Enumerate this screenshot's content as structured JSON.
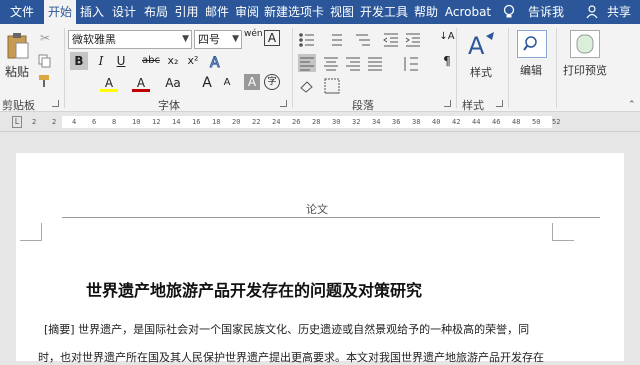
{
  "tabs": [
    "文件",
    "开始",
    "插入",
    "设计",
    "布局",
    "引用",
    "邮件",
    "审阅",
    "新建选项卡",
    "视图",
    "开发工具",
    "帮助",
    "Acrobat"
  ],
  "active_tab": "开始",
  "tell_me": "告诉我",
  "share": "共享",
  "clipboard": {
    "paste_label": "粘贴",
    "group_label": "剪贴板"
  },
  "font": {
    "name": "微软雅黑",
    "size": "四号",
    "group_label": "字体",
    "bold": "B",
    "italic": "I",
    "underline": "U",
    "strike": "abc",
    "subscript": "x₂",
    "superscript": "x²",
    "phonetic": "wén",
    "clear_format": "A",
    "highlight": "A",
    "color": "A",
    "case": "Aa",
    "grow": "A",
    "shrink": "A",
    "shade": "A",
    "enclose": "字"
  },
  "paragraph": {
    "group_label": "段落"
  },
  "styles": {
    "label": "样式",
    "group_label": "样式"
  },
  "editing": {
    "label": "编辑"
  },
  "print_preview": {
    "label": "打印预览"
  },
  "ruler_numbers": [
    "2",
    "2",
    "4",
    "6",
    "8",
    "10",
    "12",
    "14",
    "16",
    "18",
    "20",
    "22",
    "24",
    "26",
    "28",
    "30",
    "32",
    "34",
    "36",
    "38",
    "40",
    "42",
    "44",
    "46",
    "48",
    "50",
    "52"
  ],
  "document": {
    "header": "论文",
    "title": "世界遗产地旅游产品开发存在的问题及对策研究",
    "line1": "[摘要] 世界遗产，是国际社会对一个国家民族文化、历史遗迹或自然景观给予的一种极高的荣誉，同",
    "line2": "时，也对世界遗产所在国及其人民保护世界遗产提出更高要求。本文对我国世界遗产地旅游产品开发存在"
  },
  "colors": {
    "brand": "#2b579a",
    "highlight": "#ffff00",
    "font_color": "#c00000"
  }
}
